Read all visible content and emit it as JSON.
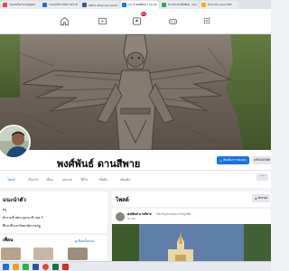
{
  "browser": {
    "tabs": [
      {
        "label": "ระบบบริหารงานบุคคล",
        "favicon_color": "#e0483e"
      },
      {
        "label": "ระบบบริหารจัดการสารสนเทศ",
        "favicon_color": "#2b6fb6"
      },
      {
        "label": "Office Business Solution",
        "favicon_color": "#3b5998"
      },
      {
        "label": "(1) ค่าพงศ์พันธ์ | Facebook",
        "favicon_color": "#1877f2",
        "active": true
      },
      {
        "label": "ข่าวประชาสัมพันธ์ - Google",
        "favicon_color": "#34a853"
      },
      {
        "label": "ประกาศ | Sauf PDF",
        "favicon_color": "#f4b400"
      }
    ]
  },
  "nav": {
    "icons": [
      "home-icon",
      "video-icon",
      "groups-icon",
      "gaming-icon"
    ],
    "badge": "9+"
  },
  "profile": {
    "name": "พงศ์พันธ์ ดานสีพาย",
    "add_story_label": "เพิ่มเรื่องราวของคุณ",
    "edit_profile_label": "แก้ไขโปรไฟล์",
    "tabs": [
      "โพสต์",
      "เกี่ยวกับ",
      "เพื่อน",
      "รูปภาพ",
      "วิดีโอ",
      "เช็คอิน",
      "เพิ่มเติม"
    ]
  },
  "intro": {
    "title": "แนะนำตัว",
    "line1": "ครู",
    "line2": "ทำงานที่ สพป.อุดรธานี เขต 3",
    "line3": "ศึกษาที่ มหาวิทยาลัยราชภัฏ",
    "friends_title": "เพื่อน",
    "friends_link": "ดูเพื่อนทั้งหมด"
  },
  "posts": {
    "title": "โพสต์",
    "filter_label": "ตัวกรอง",
    "author": "พงศ์พันธ์ ดานสีพาย",
    "action": "ได้แชร์รูปภาพของ ค่ายลูกเสือ",
    "time": "11 ชม."
  },
  "colors": {
    "facebook_blue": "#1b74e4",
    "background": "#f0f2f5",
    "notification_red": "#e41e3f"
  }
}
